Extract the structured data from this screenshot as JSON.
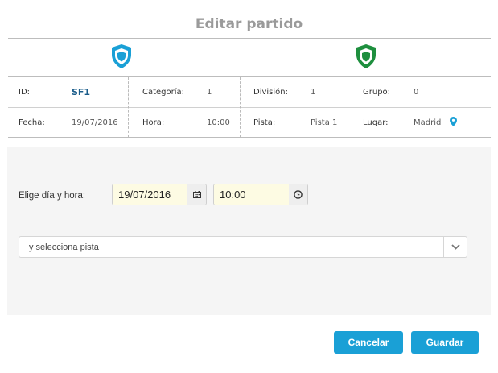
{
  "dialog": {
    "title": "Editar partido"
  },
  "teams": {
    "home_shield_color": "#1aa0d6",
    "away_shield_color": "#1e8f3e"
  },
  "match": {
    "row1": [
      {
        "label": "ID:",
        "value": "SF1"
      },
      {
        "label": "Categoría:",
        "value": "1"
      },
      {
        "label": "División:",
        "value": "1"
      },
      {
        "label": "Grupo:",
        "value": "0"
      }
    ],
    "row2": [
      {
        "label": "Fecha:",
        "value": "19/07/2016"
      },
      {
        "label": "Hora:",
        "value": "10:00"
      },
      {
        "label": "Pista:",
        "value": "Pista 1"
      },
      {
        "label": "Lugar:",
        "value": "Madrid"
      }
    ]
  },
  "form": {
    "pick_label": "Elige día y hora:",
    "date_value": "19/07/2016",
    "date_icon": "calendar-icon",
    "time_value": "10:00",
    "time_icon": "clock-icon",
    "pista_placeholder": "y selecciona pista",
    "pista_icon": "chevron-down-icon"
  },
  "buttons": {
    "cancel": "Cancelar",
    "save": "Guardar"
  },
  "colors": {
    "accent": "#1aa0d6",
    "id_value": "#1a5c8a",
    "panel": "#f5f5f5"
  }
}
